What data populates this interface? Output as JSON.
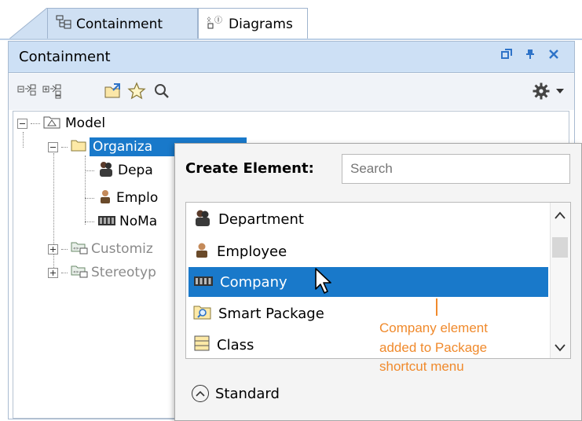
{
  "tabs": [
    {
      "label": "Containment",
      "icon": "containment-tree-icon",
      "active": true
    },
    {
      "label": "Diagrams",
      "icon": "diagrams-icon",
      "active": false
    }
  ],
  "panel": {
    "title": "Containment",
    "title_icons": [
      "restore-icon",
      "pin-icon",
      "close-icon"
    ]
  },
  "toolbar": {
    "left_icons": [
      "collapse-all-icon",
      "expand-all-icon",
      "open-package-icon",
      "favorites-star-icon",
      "search-icon"
    ],
    "right_icons": [
      "gear-icon",
      "dropdown-arrow-icon"
    ]
  },
  "tree": {
    "model": "Model",
    "organization": "Organiza",
    "department": "Depa",
    "employee": "Emplo",
    "nomagic": "NoMa",
    "customization": "Customiz",
    "stereotypes": "Stereotyp"
  },
  "popup": {
    "create_label": "Create Element:",
    "search_placeholder": "Search",
    "items": [
      {
        "label": "Department",
        "icon": "department-icon"
      },
      {
        "label": "Employee",
        "icon": "employee-icon"
      },
      {
        "label": "Company",
        "icon": "company-icon",
        "selected": true
      },
      {
        "label": "Smart Package",
        "icon": "smart-package-icon"
      },
      {
        "label": "Class",
        "icon": "class-icon"
      }
    ],
    "standard_label": "Standard"
  },
  "annotation": {
    "line1": "Company element",
    "line2": "added to Package",
    "line3": "shortcut menu",
    "color": "#f08a2c"
  },
  "colors": {
    "selection": "#1979ca",
    "tab_active": "#cfe0f3",
    "panel_title": "#cde0f5"
  }
}
